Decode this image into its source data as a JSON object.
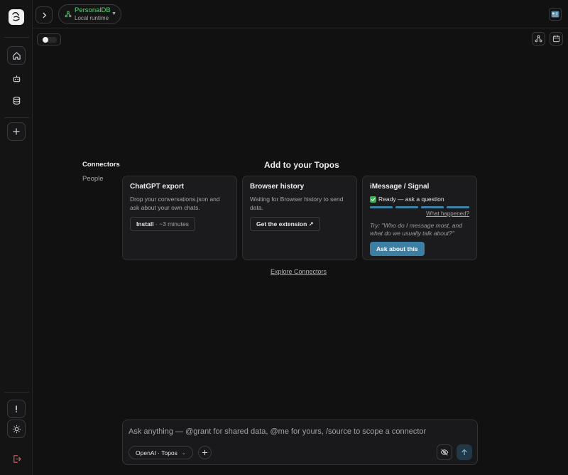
{
  "app": {
    "db_name": "PersonalDB",
    "db_subtitle": "Local runtime"
  },
  "side_nav": {
    "items": [
      {
        "label": "Connectors",
        "active": true
      },
      {
        "label": "People",
        "active": false
      }
    ]
  },
  "main": {
    "title": "Add to your Topos",
    "explore_link": "Explore Connectors"
  },
  "cards": [
    {
      "title": "ChatGPT export",
      "description": "Drop your conversations.json and ask about your own chats.",
      "button_strong": "Install",
      "button_rest": " · ~3 minutes"
    },
    {
      "title": "Browser history",
      "description": "Waiting for Browser history to send data.",
      "button_label": "Get the extension ↗"
    },
    {
      "title": "iMessage / Signal",
      "status": "Ready — ask a question",
      "progress_segments_filled": 4,
      "progress_segments_total": 4,
      "link": "What happened?",
      "hint": "Try: \"Who do I message most, and what do we usually talk about?\"",
      "button_label": "Ask about this"
    }
  ],
  "composer": {
    "placeholder": "Ask anything — @grant for shared data, @me for yours, /source to scope a connector",
    "model_label": "OpenAI · Topos"
  },
  "colors": {
    "accent_green": "#5fcf7a",
    "accent_blue": "#3c7ea4"
  }
}
